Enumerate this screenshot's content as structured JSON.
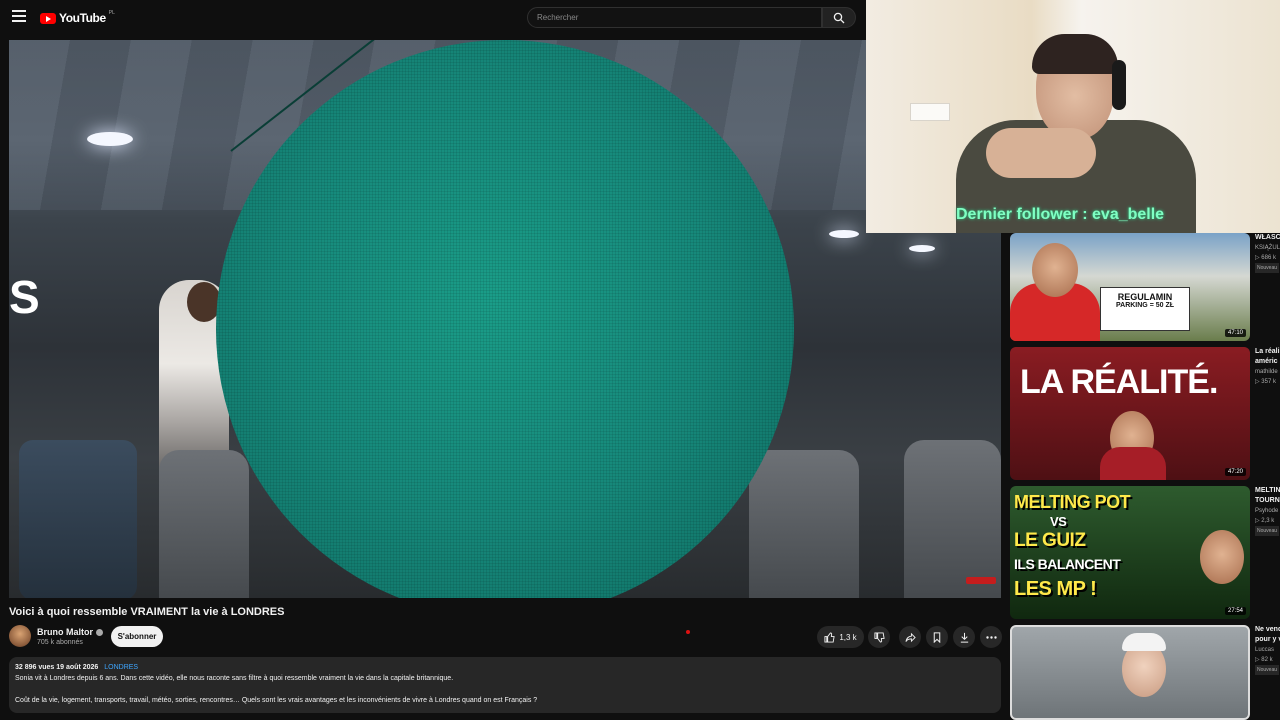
{
  "header": {
    "logo_text": "YouTube",
    "logo_country": "PL",
    "search_placeholder": "Rechercher"
  },
  "video": {
    "title": "Voici à quoi ressemble VRAIMENT la vie à LONDRES",
    "overlay_text": "S"
  },
  "channel": {
    "name": "Bruno Maltor",
    "subscribers": "705 k abonnés",
    "subscribe_label": "S'abonner"
  },
  "actions": {
    "like_count": "1,3 k"
  },
  "description": {
    "views": "32 896 vues",
    "date": "19 août 2026",
    "tag": "LONDRES",
    "line1": "Sonia vit à Londres depuis 6 ans. Dans cette vidéo, elle nous raconte sans filtre à quoi ressemble vraiment la vie dans la capitale britannique.",
    "line2": "Coût de la vie, logement, transports, travail, météo, sorties, rencontres… Quels sont les vrais avantages et les inconvénients de vivre à Londres quand on est Français ?"
  },
  "webcam": {
    "follower_text": "Dernier follower : eva_belle"
  },
  "recommendations": [
    {
      "duration": "47:10",
      "title": "WŁASC",
      "channel": "KSIĄŻUL",
      "views": "▷ 686 k",
      "badge": "Nouveau",
      "thumb_text": "REGULAMIN",
      "thumb_sub": "PARKING = 50 ZŁ"
    },
    {
      "duration": "47:20",
      "title": "La réali",
      "title2": "améric",
      "channel": "mathilde",
      "views": "▷ 357 k",
      "thumb_text": "LA RÉALITÉ."
    },
    {
      "duration": "27:54",
      "title": "MELTIN",
      "title2": "TOURN",
      "channel": "Psyhode",
      "views": "▷ 2,3 k",
      "badge": "Nouveau",
      "thumb_line1": "MELTING POT",
      "thumb_line2": "VS",
      "thumb_line3": "LE GUIZ",
      "thumb_line4": "ILS BALANCENT",
      "thumb_line5": "LES MP !"
    },
    {
      "title": "Ne vend",
      "title2": "pour y v",
      "channel": "Luccas",
      "views": "▷ 82 k",
      "badge": "Nouveau"
    }
  ]
}
